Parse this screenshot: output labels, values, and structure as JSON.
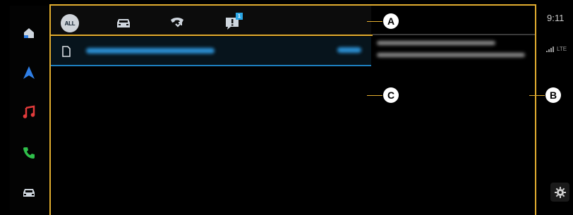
{
  "sidebar": {
    "items": [
      {
        "icon": "home-icon",
        "color": "#cfd6de"
      },
      {
        "icon": "navigation-icon",
        "color": "#2f7fe6"
      },
      {
        "icon": "music-icon",
        "color": "#e23b3b"
      },
      {
        "icon": "phone-icon",
        "color": "#2fbf4a"
      },
      {
        "icon": "car-icon",
        "color": "#cfd6de"
      }
    ]
  },
  "tabs": [
    {
      "label": "ALL",
      "icon": "all-icon",
      "selected": true
    },
    {
      "icon": "car-icon"
    },
    {
      "icon": "missed-call-icon"
    },
    {
      "icon": "info-message-icon",
      "badge": "1"
    }
  ],
  "list": {
    "rows": [
      {
        "icon": "document-icon",
        "selected": true
      }
    ]
  },
  "status": {
    "time": "9:11",
    "network": "LTE"
  },
  "callouts": {
    "a": "A",
    "b": "B",
    "c": "C"
  },
  "colors": {
    "accent_frame": "#e2ad2f",
    "highlight": "#1d7fbf",
    "background": "#000000"
  }
}
